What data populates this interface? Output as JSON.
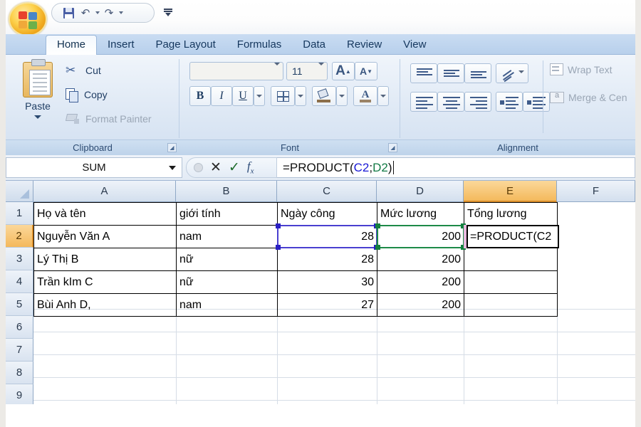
{
  "app": {
    "office_button": "office-orb",
    "quick_access": [
      {
        "name": "save",
        "icon": "save-icon",
        "label": "Save"
      },
      {
        "name": "undo",
        "icon": "undo-icon",
        "label": "Undo"
      },
      {
        "name": "redo",
        "icon": "redo-icon",
        "label": "Redo"
      }
    ],
    "qat_customize_label": "Customize Quick Access Toolbar"
  },
  "tabs": [
    {
      "label": "Home",
      "active": true
    },
    {
      "label": "Insert",
      "active": false
    },
    {
      "label": "Page Layout",
      "active": false
    },
    {
      "label": "Formulas",
      "active": false
    },
    {
      "label": "Data",
      "active": false
    },
    {
      "label": "Review",
      "active": false
    },
    {
      "label": "View",
      "active": false
    }
  ],
  "ribbon": {
    "clipboard": {
      "group_label": "Clipboard",
      "paste_label": "Paste",
      "cut_label": "Cut",
      "copy_label": "Copy",
      "format_painter_label": "Format Painter"
    },
    "font": {
      "group_label": "Font",
      "font_name_value": "",
      "font_size_value": "11",
      "grow_font_label": "A",
      "shrink_font_label": "A",
      "bold_label": "B",
      "italic_label": "I",
      "underline_label": "U"
    },
    "alignment": {
      "group_label": "Alignment",
      "wrap_text_label": "Wrap Text",
      "merge_center_label": "Merge & Cen"
    }
  },
  "formula_bar": {
    "name_box_value": "SUM",
    "cancel_label": "✕",
    "enter_label": "✓",
    "insert_function_label": "fx",
    "formula_prefix": "=PRODUCT(",
    "formula_ref1": "C2",
    "formula_separator": ";",
    "formula_ref2": "D2",
    "formula_suffix": ")",
    "formula_full": "=PRODUCT(C2;D2)"
  },
  "sheet": {
    "columns": [
      "A",
      "B",
      "C",
      "D",
      "E",
      "F"
    ],
    "selected_column": "E",
    "rows": [
      "1",
      "2",
      "3",
      "4",
      "5",
      "6",
      "7",
      "8",
      "9"
    ],
    "selected_row": "2",
    "active_cell": "E2",
    "active_cell_edit_text": "=PRODUCT(C2",
    "headers": {
      "A": "Họ và tên",
      "B": "giới tính",
      "C": "Ngày công",
      "D": "Mức lương",
      "E": "Tổng lương"
    },
    "data_rows": [
      {
        "row": "2",
        "A": "Nguyễn Văn A",
        "B": "nam",
        "C": "28",
        "D": "200",
        "E": ""
      },
      {
        "row": "3",
        "A": "Lý Thị B",
        "B": "nữ",
        "C": "28",
        "D": "200",
        "E": ""
      },
      {
        "row": "4",
        "A": "Trần kIm C",
        "B": "nữ",
        "C": "30",
        "D": "200",
        "E": ""
      },
      {
        "row": "5",
        "A": "Bùi Anh D,",
        "B": "nam",
        "C": "27",
        "D": "200",
        "E": ""
      }
    ],
    "reference_highlights": [
      {
        "ref": "C2",
        "color": "#4a3fd0"
      },
      {
        "ref": "D2",
        "color": "#1d8a48"
      }
    ]
  },
  "colors": {
    "tab_active_bg": "#ffffff",
    "ribbon_bg": "#e2ebf6",
    "header_selected": "#f4b95c",
    "ref_blue": "#1a1ad6",
    "ref_green": "#127a45"
  }
}
